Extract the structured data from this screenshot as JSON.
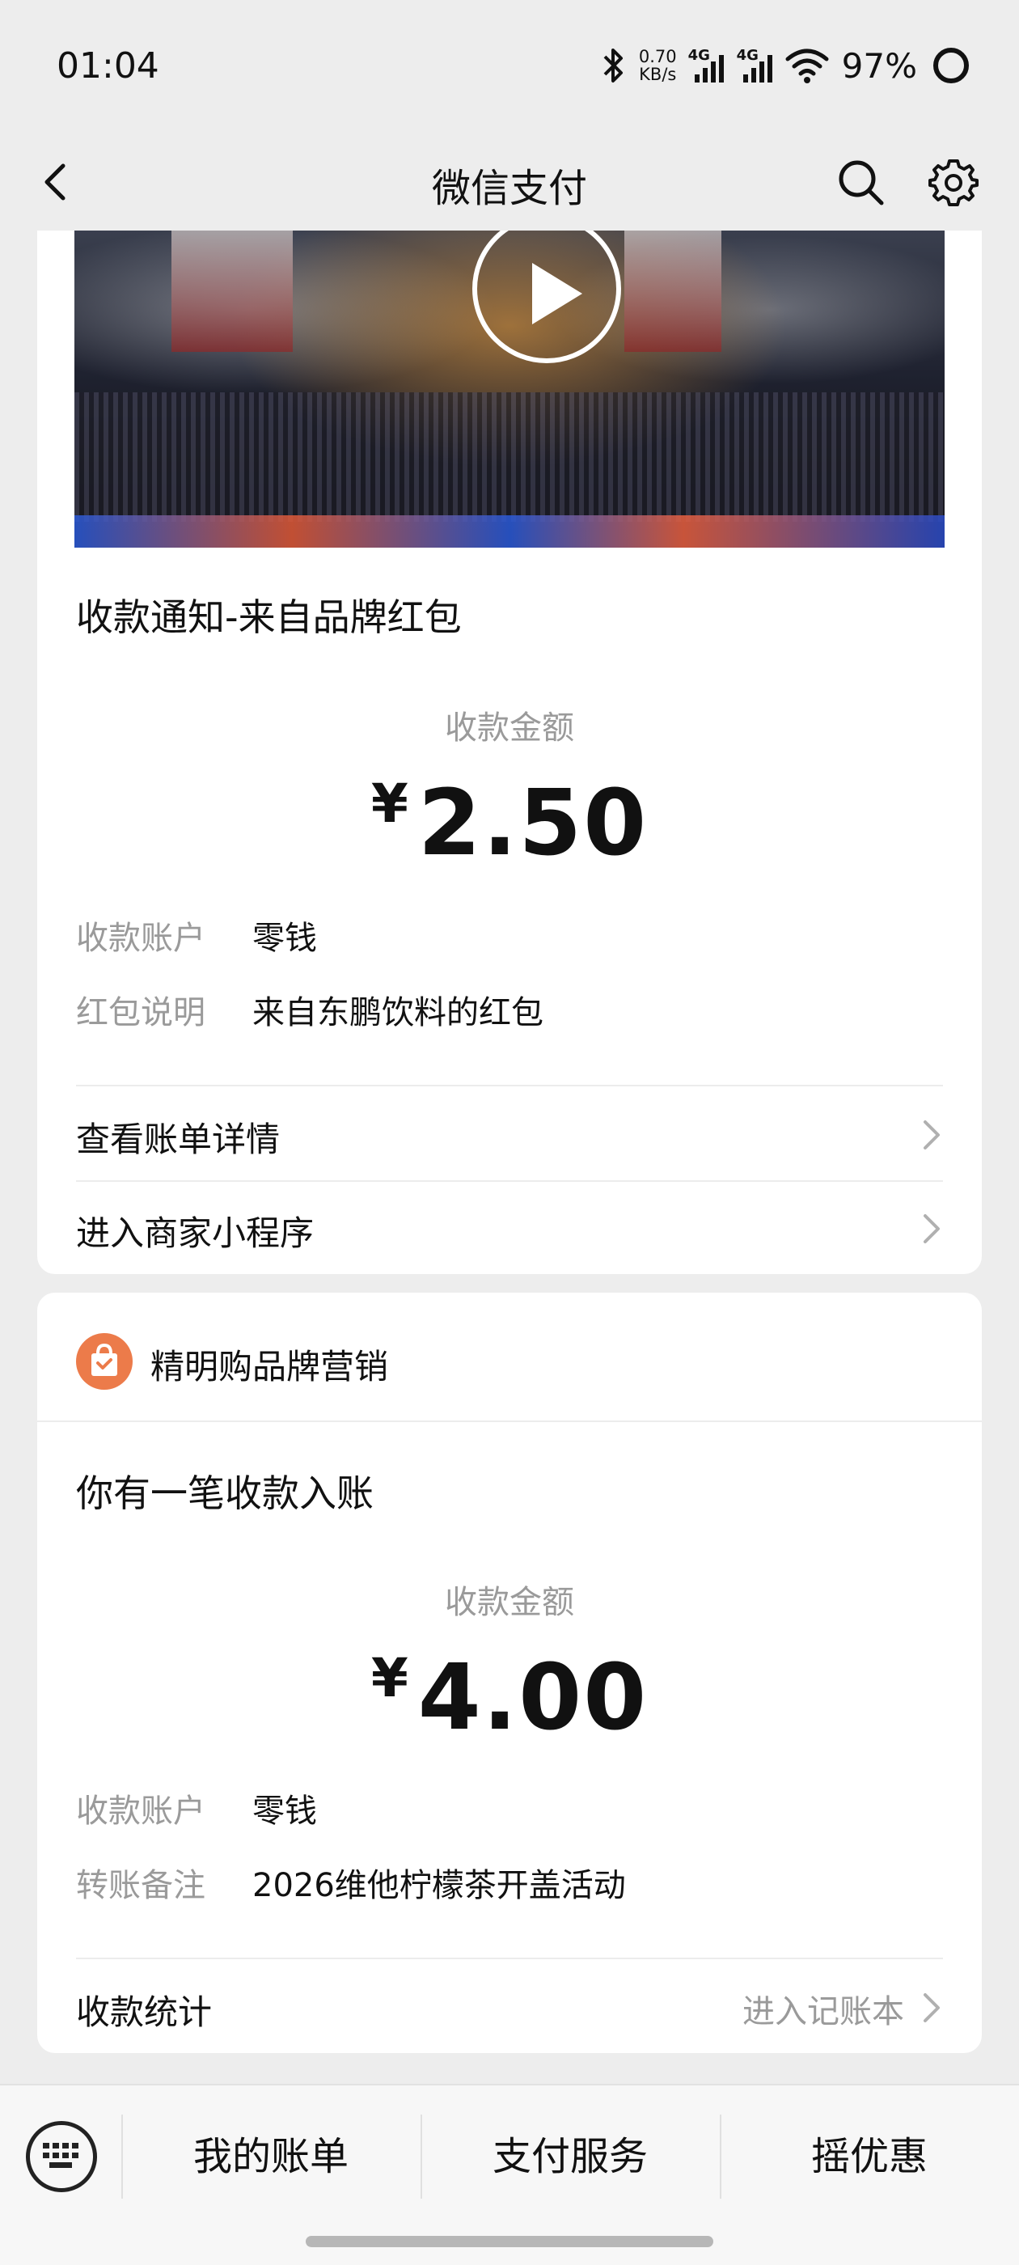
{
  "status_bar": {
    "time": "01:04",
    "net_speed_value": "0.70",
    "net_speed_unit": "KB/s",
    "network_1": "4G",
    "network_2": "4G",
    "battery": "97%"
  },
  "navbar": {
    "title": "微信支付"
  },
  "card1": {
    "title": "收款通知-来自品牌红包",
    "amount_label": "收款金额",
    "currency": "¥",
    "amount": "2.50",
    "rows": [
      {
        "label": "收款账户",
        "value": "零钱"
      },
      {
        "label": "红包说明",
        "value": "来自东鹏饮料的红包"
      }
    ],
    "links": [
      {
        "label": "查看账单详情"
      },
      {
        "label": "进入商家小程序"
      }
    ]
  },
  "card2": {
    "brand_name": "精明购品牌营销",
    "title": "你有一笔收款入账",
    "amount_label": "收款金额",
    "currency": "¥",
    "amount": "4.00",
    "rows": [
      {
        "label": "收款账户",
        "value": "零钱"
      },
      {
        "label": "转账备注",
        "value": "2026维他柠檬茶开盖活动"
      }
    ],
    "stats_label": "收款统计",
    "stats_link": "进入记账本"
  },
  "bottom_tabs": [
    "我的账单",
    "支付服务",
    "摇优惠"
  ],
  "icons": {
    "back": "chevron-left-icon",
    "search": "search-icon",
    "settings": "gear-icon",
    "play": "play-icon",
    "keyboard": "keyboard-icon",
    "brand": "shopping-bag-icon"
  },
  "colors": {
    "background": "#ededed",
    "card": "#ffffff",
    "secondary_text": "#9a9a9a",
    "brand_logo": "#ec7b4a"
  }
}
